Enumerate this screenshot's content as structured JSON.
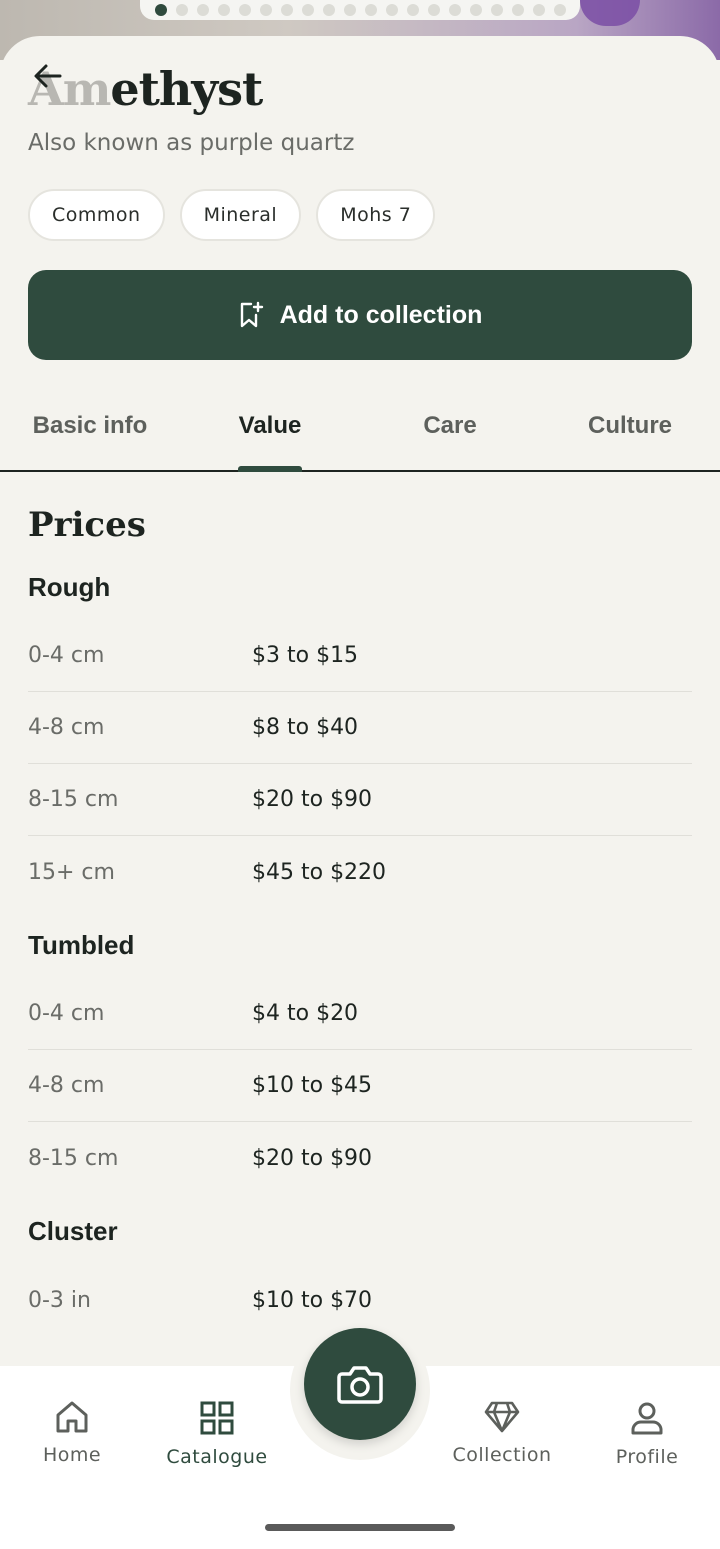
{
  "header": {
    "title_faded": "Am",
    "title_rest": "ethyst",
    "subtitle": "Also known as purple quartz"
  },
  "chips": [
    "Common",
    "Mineral",
    "Mohs 7"
  ],
  "add_button": {
    "label": "Add to collection"
  },
  "tabs": [
    {
      "label": "Basic info",
      "active": false
    },
    {
      "label": "Value",
      "active": true
    },
    {
      "label": "Care",
      "active": false
    },
    {
      "label": "Culture",
      "active": false
    }
  ],
  "prices": {
    "heading": "Prices",
    "groups": [
      {
        "title": "Rough",
        "rows": [
          {
            "size": "0-4 cm",
            "price": "$3 to $15"
          },
          {
            "size": "4-8 cm",
            "price": "$8 to $40"
          },
          {
            "size": "8-15 cm",
            "price": "$20 to $90"
          },
          {
            "size": "15+ cm",
            "price": "$45 to $220"
          }
        ]
      },
      {
        "title": "Tumbled",
        "rows": [
          {
            "size": "0-4 cm",
            "price": "$4 to $20"
          },
          {
            "size": "4-8 cm",
            "price": "$10 to $45"
          },
          {
            "size": "8-15 cm",
            "price": "$20 to $90"
          }
        ]
      },
      {
        "title": "Cluster",
        "rows": [
          {
            "size": "0-3 in",
            "price": "$10 to $70"
          }
        ]
      }
    ]
  },
  "nav": {
    "items": [
      {
        "label": "Home",
        "icon": "home-icon"
      },
      {
        "label": "Catalogue",
        "icon": "grid-icon",
        "active": true
      },
      {
        "label": "Collection",
        "icon": "diamond-icon"
      },
      {
        "label": "Profile",
        "icon": "person-icon"
      }
    ],
    "fab_icon": "camera-icon"
  },
  "carousel": {
    "total": 20,
    "active_index": 0
  },
  "colors": {
    "accent": "#2f4b3e",
    "background": "#f4f3ee"
  }
}
